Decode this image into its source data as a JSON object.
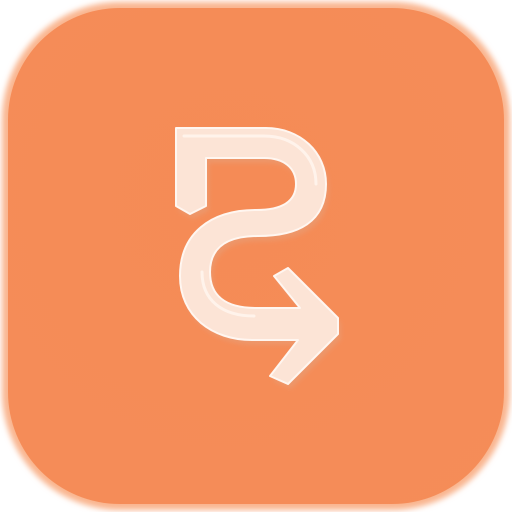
{
  "icon": {
    "name": "curved-arrow-logo-icon",
    "background_color": "#F58B56",
    "edge_color": "#F9B58F",
    "glyph_fill": "#FCE4D6",
    "glyph_highlight": "#FFF6F0",
    "glyph_shadow": "#E7A07A"
  }
}
